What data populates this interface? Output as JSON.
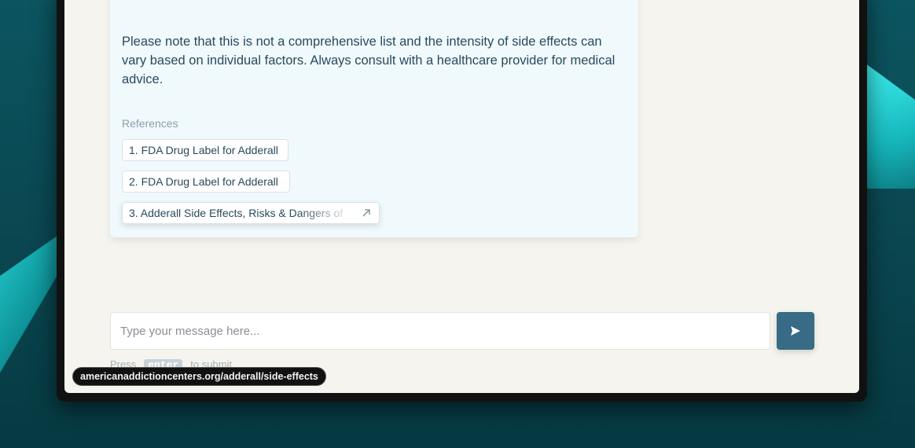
{
  "answer": {
    "paragraph": "Please note that this is not a comprehensive list and the intensity of side effects can vary based on individual factors. Always consult with a healthcare provider for medical advice.",
    "references_label": "References",
    "references": [
      {
        "label": "1. FDA Drug Label for Adderall"
      },
      {
        "label": "2. FDA Drug Label for Adderall"
      },
      {
        "label": "3. Adderall Side Effects, Risks & Dangers of",
        "icon": "external-link-icon"
      }
    ]
  },
  "composer": {
    "placeholder": "Type your message here...",
    "send_icon": "send-icon",
    "hint_prefix": "Press",
    "hint_key": "enter",
    "hint_suffix": "to submit"
  },
  "status_tooltip": {
    "url": "americanaddictioncenters.org/adderall/side-effects"
  },
  "colors": {
    "send_button": "#386b86",
    "card_background": "#f0f9fc",
    "text": "#2a4a5e"
  }
}
